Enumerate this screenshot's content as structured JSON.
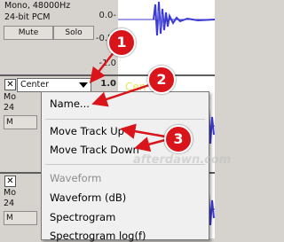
{
  "track_top": {
    "format_line": "Mono, 48000Hz",
    "bits_line": "24-bit PCM",
    "mute_label": "Mute",
    "solo_label": "Solo",
    "scale": [
      "0.0-",
      "-0.5-",
      "-1.0"
    ]
  },
  "track_mid": {
    "close_glyph": "✕",
    "name": "Center",
    "scale_top": "1.0",
    "rows": [
      "Mo",
      "24",
      "M"
    ],
    "clip_text": "Cen"
  },
  "track_bottom": {
    "close_glyph": "✕",
    "rows": [
      "Mo",
      "24",
      "M"
    ]
  },
  "menu": {
    "items": [
      "Name...",
      "Move Track Up",
      "Move Track Down",
      "Waveform",
      "Waveform (dB)",
      "Spectrogram",
      "Spectrogram log(f)"
    ],
    "dim_index": 3
  },
  "callouts": [
    "1",
    "2",
    "3"
  ],
  "watermark": "afterdawn.com",
  "colors": {
    "callout": "#d9141b",
    "wave": "#3b3bd1",
    "clip": "#e8e25a"
  }
}
